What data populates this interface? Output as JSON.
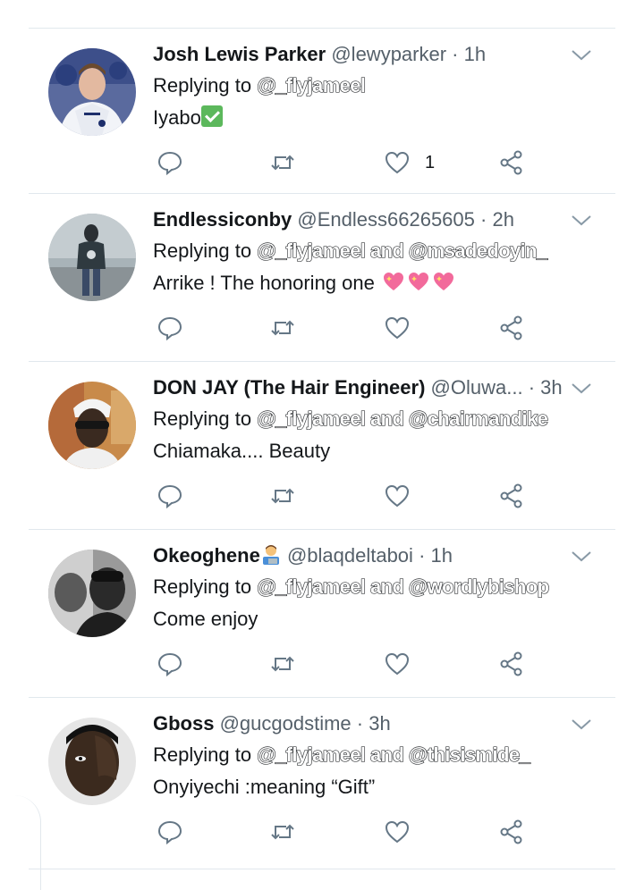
{
  "reply_prefix": "Replying to ",
  "and_word": " and ",
  "tweets": [
    {
      "name": "Josh Lewis Parker",
      "handle": "@lewyparker",
      "time": "1h",
      "mentions": [
        "@_flyjameel"
      ],
      "text": "Iyabo",
      "emoji": "check-mark-button-emoji",
      "like_count": "1"
    },
    {
      "name": "Endlessiconby",
      "handle": "@Endless66265605",
      "time": "2h",
      "mentions": [
        "@_flyjameel",
        "@msadedoyin_"
      ],
      "text": "Arrike ! The honoring one ",
      "emoji": "sparkling-heart-emoji",
      "like_count": ""
    },
    {
      "name": "DON JAY (The Hair Engineer)",
      "handle": "@Oluwa...",
      "time": "3h",
      "mentions": [
        "@_flyjameel",
        "@chairmandike"
      ],
      "text": "Chiamaka.... Beauty",
      "like_count": ""
    },
    {
      "name": "Okeoghene",
      "handle": "@blaqdeltaboi",
      "time": "1h",
      "mentions": [
        "@_flyjameel",
        "@wordlybishop"
      ],
      "text": "Come enjoy",
      "emoji": "man-technologist-emoji",
      "like_count": ""
    },
    {
      "name": "Gboss",
      "handle": "@gucgodstime",
      "time": "3h",
      "mentions": [
        "@_flyjameel",
        "@thisismide_"
      ],
      "text": "Onyiyechi :meaning “Gift”",
      "like_count": ""
    }
  ],
  "colors": {
    "text": "#14171a",
    "secondary": "#55606a",
    "icon": "#657786",
    "divider": "#e1e8ed"
  }
}
